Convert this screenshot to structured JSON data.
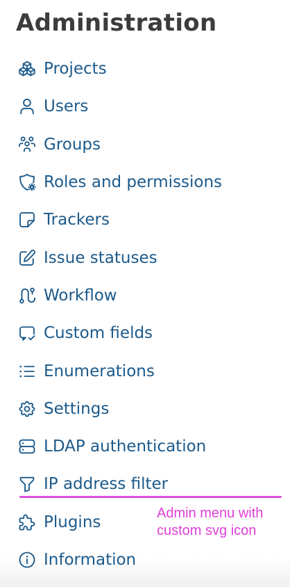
{
  "header": {
    "title": "Administration"
  },
  "menu": {
    "items": [
      {
        "label": "Projects",
        "icon": "projects-icon"
      },
      {
        "label": "Users",
        "icon": "user-icon"
      },
      {
        "label": "Groups",
        "icon": "groups-icon"
      },
      {
        "label": "Roles and permissions",
        "icon": "shield-icon"
      },
      {
        "label": "Trackers",
        "icon": "note-icon"
      },
      {
        "label": "Issue statuses",
        "icon": "edit-icon"
      },
      {
        "label": "Workflow",
        "icon": "workflow-icon"
      },
      {
        "label": "Custom fields",
        "icon": "message-check-icon"
      },
      {
        "label": "Enumerations",
        "icon": "list-icon"
      },
      {
        "label": "Settings",
        "icon": "gear-icon"
      },
      {
        "label": "LDAP authentication",
        "icon": "server-icon"
      },
      {
        "label": "IP address filter",
        "icon": "filter-icon"
      },
      {
        "label": "Plugins",
        "icon": "puzzle-icon"
      },
      {
        "label": "Information",
        "icon": "info-icon"
      }
    ]
  },
  "annotation": {
    "text": "Admin menu with\ncustom svg icon",
    "color": "#df3fd8"
  },
  "colors": {
    "title": "#3c3c3c",
    "link": "#1c5a8b"
  }
}
